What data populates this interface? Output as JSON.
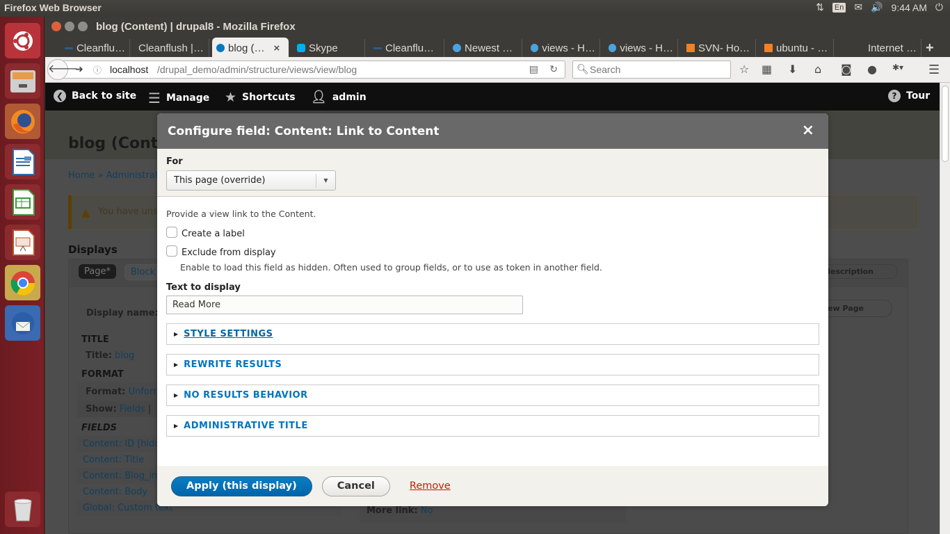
{
  "desktop": {
    "app_name": "Firefox Web Browser",
    "tray": {
      "network": "⇅",
      "keyboard": "En",
      "mail": "✉",
      "volume": "🔊",
      "time": "9:44 AM",
      "power": "⏻"
    },
    "launcher": [
      {
        "name": "ubuntu-dash-icon",
        "color": "#c5343a"
      },
      {
        "name": "files-icon",
        "color": "#8a8a8a"
      },
      {
        "name": "firefox-icon",
        "color": "#e8762c"
      },
      {
        "name": "libreoffice-writer-icon",
        "color": "#2d6ea8"
      },
      {
        "name": "libreoffice-calc-icon",
        "color": "#3b9b3a"
      },
      {
        "name": "libreoffice-impress-icon",
        "color": "#b8502a"
      },
      {
        "name": "chrome-icon",
        "color": "#d9b23a"
      },
      {
        "name": "thunderbird-icon",
        "color": "#3a72b8"
      }
    ],
    "trash": "trash-icon"
  },
  "browser": {
    "window_title": "blog (Content) | drupal8 - Mozilla Firefox",
    "tabs": [
      {
        "label": "Cleanflu…",
        "active": false
      },
      {
        "label": "Cleanflush |…",
        "active": false
      },
      {
        "label": "blog (…",
        "active": true,
        "close": "×"
      },
      {
        "label": "Skype",
        "active": false
      },
      {
        "label": "Cleanflu…",
        "active": false
      },
      {
        "label": "Newest …",
        "active": false
      },
      {
        "label": "views - H…",
        "active": false
      },
      {
        "label": "views - H…",
        "active": false
      },
      {
        "label": "SVN- Ho…",
        "active": false
      },
      {
        "label": "ubuntu - …",
        "active": false
      },
      {
        "label": "Internet …",
        "active": false
      }
    ],
    "new_tab": "+",
    "url_host": "localhost",
    "url_path": "/drupal_demo/admin/structure/views/view/blog",
    "search_placeholder": "Search"
  },
  "toolbar": {
    "back": "Back to site",
    "manage": "Manage",
    "shortcuts": "Shortcuts",
    "user": "admin",
    "tour": "Tour"
  },
  "background_page": {
    "title": "blog (Conte",
    "breadcrumb": "Home » Administrat",
    "warning": "You have uns",
    "displays_heading": "Displays",
    "display_tabs": [
      "Page*",
      "Block"
    ],
    "display_name_label": "Display name:",
    "edit_desc": "e/description",
    "view_page": "View Page",
    "title_section": "TITLE",
    "title_label": "Title:",
    "title_value": "blog",
    "format_section": "FORMAT",
    "format_label": "Format:",
    "format_value": "Unform",
    "show_label": "Show:",
    "show_value": "Fields",
    "fields_section": "FIELDS",
    "fields": [
      "Content: ID [hidd",
      "Content: Title",
      "Content: Blog_ima",
      "Content: Body",
      "Global: Custom text"
    ],
    "more_link_label": "More link:",
    "more_link_value": "No"
  },
  "dialog": {
    "title": "Configure field: Content: Link to Content",
    "close": "×",
    "for_label": "For",
    "for_value": "This page (override)",
    "description": "Provide a view link to the Content.",
    "create_label": "Create a label",
    "create_label_checked": false,
    "exclude": "Exclude from display",
    "exclude_checked": false,
    "exclude_hint": "Enable to load this field as hidden. Often used to group fields, or to use as token in another field.",
    "text_label": "Text to display",
    "text_value": "Read More",
    "sections": [
      "STYLE SETTINGS",
      "REWRITE RESULTS",
      "NO RESULTS BEHAVIOR",
      "ADMINISTRATIVE TITLE"
    ],
    "apply": "Apply (this display)",
    "cancel": "Cancel",
    "remove": "Remove"
  }
}
